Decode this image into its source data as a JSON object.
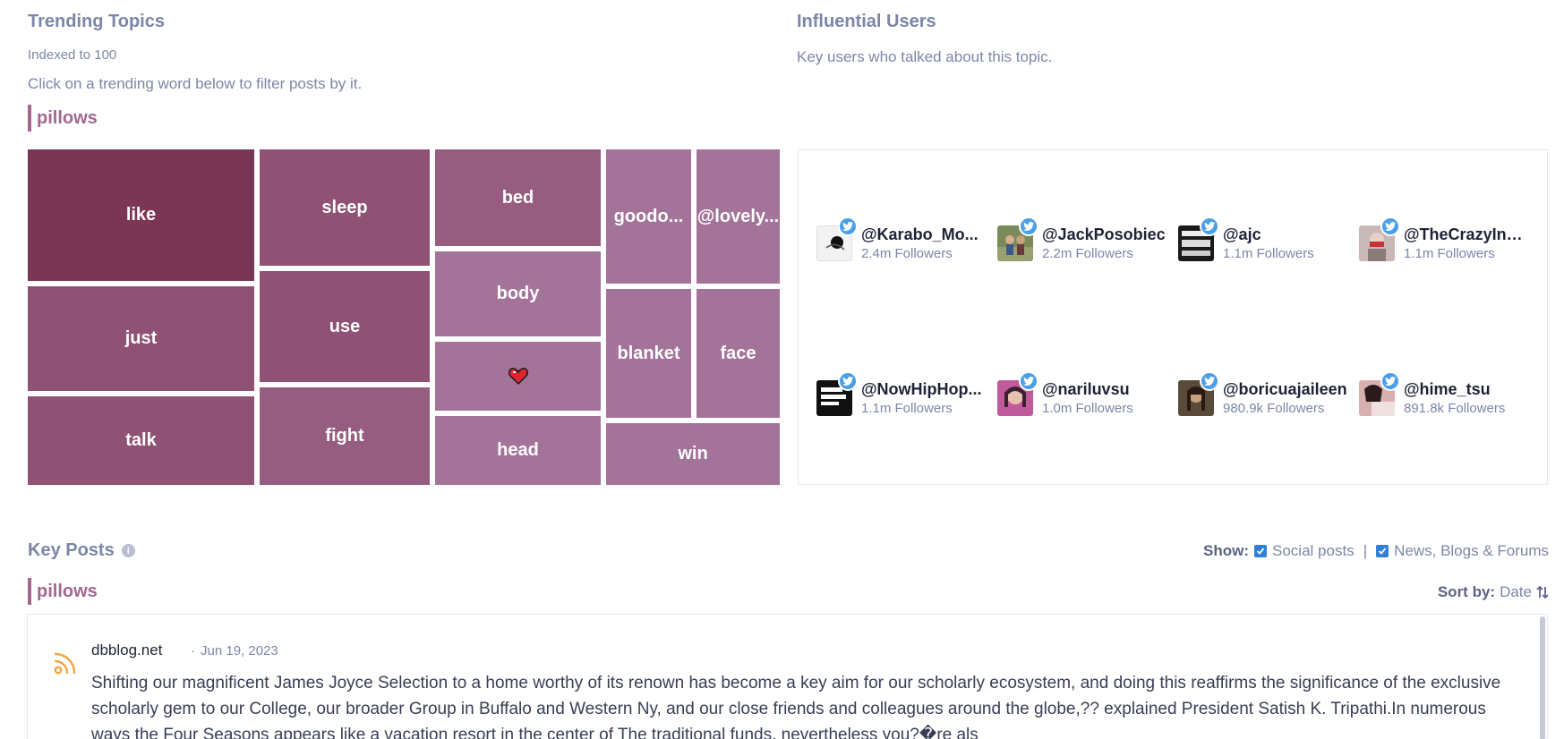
{
  "trending": {
    "title": "Trending Topics",
    "subtitle": "Indexed to 100",
    "instruction": "Click on a trending word below to filter posts by it.",
    "selected": "pillows",
    "words": [
      {
        "label": "like",
        "color": "#7c3655"
      },
      {
        "label": "just",
        "color": "#8f5274"
      },
      {
        "label": "talk",
        "color": "#8f5274"
      },
      {
        "label": "sleep",
        "color": "#8f5274"
      },
      {
        "label": "use",
        "color": "#8f5274"
      },
      {
        "label": "fight",
        "color": "#965d80"
      },
      {
        "label": "bed",
        "color": "#965d80"
      },
      {
        "label": "body",
        "color": "#a3739a"
      },
      {
        "label": "heart-emoji",
        "color": "#a3739a"
      },
      {
        "label": "head",
        "color": "#a3739a"
      },
      {
        "label": "goodo...",
        "color": "#a3739a"
      },
      {
        "label": "@lovely...",
        "color": "#a3739a"
      },
      {
        "label": "blanket",
        "color": "#a3739a"
      },
      {
        "label": "face",
        "color": "#a3739a"
      },
      {
        "label": "win",
        "color": "#a3739a"
      }
    ]
  },
  "influencers": {
    "title": "Influential Users",
    "subtitle": "Key users who talked about this topic.",
    "users": [
      {
        "handle": "@Karabo_Mo...",
        "followers": "2.4m Followers",
        "avatar_color": "#f2f2f2"
      },
      {
        "handle": "@JackPosobiec",
        "followers": "2.2m Followers",
        "avatar_color": "#7a8a5a"
      },
      {
        "handle": "@ajc",
        "followers": "1.1m Followers",
        "avatar_color": "#1a1a1a"
      },
      {
        "handle": "@TheCrazyInS...",
        "followers": "1.1m Followers",
        "avatar_color": "#c9b8b8"
      },
      {
        "handle": "@NowHipHop...",
        "followers": "1.1m Followers",
        "avatar_color": "#111111"
      },
      {
        "handle": "@nariluvsu",
        "followers": "1.0m Followers",
        "avatar_color": "#c05a9a"
      },
      {
        "handle": "@boricuajaileen",
        "followers": "980.9k Followers",
        "avatar_color": "#5a4a3a"
      },
      {
        "handle": "@hime_tsu",
        "followers": "891.8k Followers",
        "avatar_color": "#d8b0b0"
      }
    ]
  },
  "key_posts": {
    "title": "Key Posts",
    "selected": "pillows",
    "show_label": "Show:",
    "filter_social": "Social posts",
    "separator": "|",
    "filter_news": "News, Blogs & Forums",
    "sort_label": "Sort by:",
    "sort_value": "Date",
    "post": {
      "source": "dbblog.net",
      "dot": "·",
      "date": "Jun 19, 2023",
      "text": "Shifting our magnificent James Joyce Selection to a home worthy of its renown has become a key aim for our scholarly ecosystem, and doing this reaffirms the significance of the exclusive scholarly gem to our College, our broader Group in Buffalo and Western Ny, and our close friends and colleagues around the globe,?? explained President Satish K. Tripathi.In numerous ways the Four Seasons appears like a vacation resort in the center of The traditional funds, nevertheless you?�re als"
    }
  }
}
